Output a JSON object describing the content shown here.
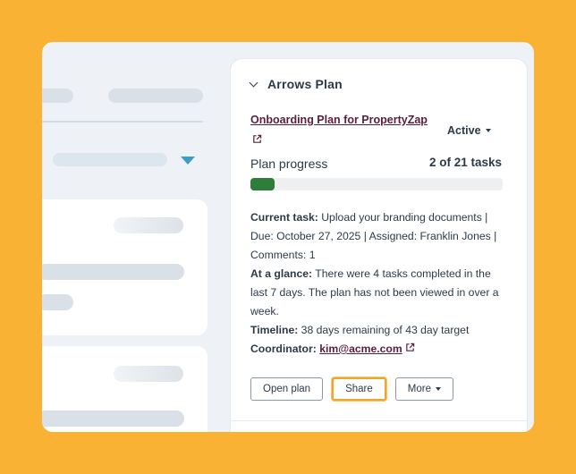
{
  "panel": {
    "title": "Arrows Plan",
    "plan_link": "Onboarding Plan for PropertyZap",
    "status": "Active",
    "progress_label": "Plan progress",
    "progress_count": "2 of 21 tasks",
    "progress_fraction": 0.095,
    "current_task_label": "Current task:",
    "current_task_text": "Upload your branding documents | Due: October 27, 2025 | Assigned: Franklin Jones | Comments: 1",
    "glance_label": "At a glance:",
    "glance_text": "There were 4 tasks completed in the last 7 days. The plan has not been viewed in over a week.",
    "timeline_label": "Timeline:",
    "timeline_text": "38 days remaining of 43 day target",
    "coordinator_label": "Coordinator:",
    "coordinator_email": "kim@acme.com",
    "buttons": {
      "open_plan": "Open plan",
      "share": "Share",
      "more": "More"
    }
  },
  "colors": {
    "background": "#F9B233",
    "link": "#5B1E3A",
    "progress": "#2E7D3B",
    "focus": "#F0A52C",
    "accent_arrow": "#3C9DC8"
  }
}
